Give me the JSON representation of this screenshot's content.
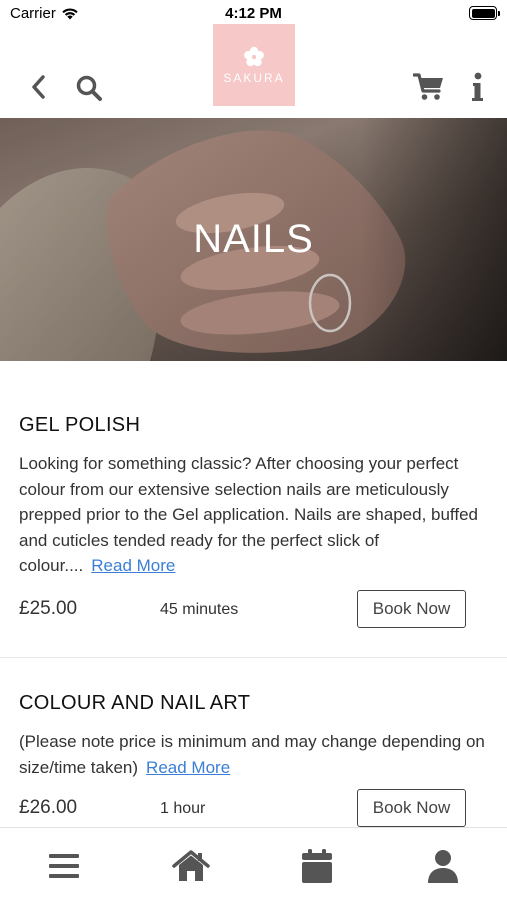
{
  "status_bar": {
    "carrier": "Carrier",
    "time": "4:12 PM"
  },
  "nav": {
    "logo_text": "SAKURA",
    "back_icon": "chevron-left-icon",
    "search_icon": "search-icon",
    "cart_icon": "cart-icon",
    "info_icon": "info-icon"
  },
  "hero": {
    "title": "NAILS"
  },
  "services": [
    {
      "title": "GEL POLISH",
      "description": "Looking for something classic? After choosing your perfect colour from our extensive selection nails are meticulously prepped prior to the Gel application. Nails are shaped, buffed and cuticles tended ready for the perfect slick of colour....",
      "read_more": "Read More",
      "price": "£25.00",
      "duration": "45 minutes",
      "book_label": "Book Now"
    },
    {
      "title": "COLOUR AND NAIL ART",
      "description": "(Please note price is minimum and may change depending on size/time taken)",
      "read_more": "Read More",
      "price": "£26.00",
      "duration": "1 hour",
      "book_label": "Book Now"
    }
  ],
  "tab_bar": {
    "items": [
      "menu-icon",
      "home-icon",
      "calendar-icon",
      "profile-icon"
    ]
  },
  "colors": {
    "logo_bg": "#f6c8c8",
    "link": "#3a7fd5",
    "icon": "#555555"
  }
}
